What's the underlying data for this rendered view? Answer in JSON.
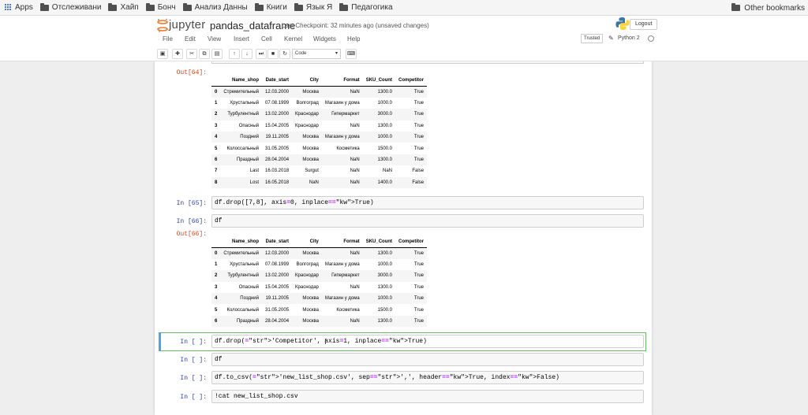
{
  "bookmarks": {
    "items": [
      "Apps",
      "Отслеживани",
      "Хайп",
      "Бонч",
      "Анализ Данны",
      "Книги",
      "Язык Я",
      "Педагогика"
    ],
    "other": "Other bookmarks"
  },
  "header": {
    "logo_text": "jupyter",
    "notebook_name": "pandas_dataframe",
    "checkpoint": "Last Checkpoint: 32 minutes ago (unsaved changes)",
    "logout": "Logout"
  },
  "menu": {
    "items": [
      "File",
      "Edit",
      "View",
      "Insert",
      "Cell",
      "Kernel",
      "Widgets",
      "Help"
    ],
    "trusted": "Trusted",
    "kernel": "Python 2"
  },
  "toolbar": {
    "cell_type": "Code"
  },
  "cells": {
    "out64_prompt": "Out[64]:",
    "in65_prompt": "In [65]:",
    "in65_code": "df.drop([7,8], axis=0, inplace=True)",
    "in66_prompt": "In [66]:",
    "in66_code": "df",
    "out66_prompt": "Out[66]:",
    "in_a_prompt": "In [ ]:",
    "in_a_code": "df.drop('Competitor', axis=1, inplace=True)",
    "in_b_prompt": "In [ ]:",
    "in_b_code": "df",
    "in_c_prompt": "In [ ]:",
    "in_c_code": "df.to_csv('new_list_shop.csv', sep=',', header=True, index=False)",
    "in_d_prompt": "In [ ]:",
    "in_d_code": "!cat new_list_shop.csv"
  },
  "table1": {
    "columns": [
      "",
      "Name_shop",
      "Date_start",
      "City",
      "Format",
      "SKU_Count",
      "Competitor"
    ],
    "rows": [
      [
        "0",
        "Стремительный",
        "12.03.2000",
        "Москва",
        "NaN",
        "1300.0",
        "True"
      ],
      [
        "1",
        "Хрустальный",
        "07.08.1999",
        "Волгоград",
        "Магазин у дома",
        "1000.0",
        "True"
      ],
      [
        "2",
        "Турбулентный",
        "13.02.2000",
        "Краснодар",
        "Гипермаркет",
        "3000.0",
        "True"
      ],
      [
        "3",
        "Опасный",
        "15.04.2005",
        "Краснодар",
        "NaN",
        "1300.0",
        "True"
      ],
      [
        "4",
        "Поздний",
        "19.11.2005",
        "Москва",
        "Магазин у дома",
        "1000.0",
        "True"
      ],
      [
        "5",
        "Колоссальный",
        "31.05.2005",
        "Москва",
        "Косметика",
        "1500.0",
        "True"
      ],
      [
        "6",
        "Праздный",
        "28.04.2004",
        "Москва",
        "NaN",
        "1300.0",
        "True"
      ],
      [
        "7",
        "Last",
        "16.03.2018",
        "Surgut",
        "NaN",
        "NaN",
        "False"
      ],
      [
        "8",
        "Lost",
        "16.05.2018",
        "NaN",
        "NaN",
        "1400.0",
        "False"
      ]
    ]
  },
  "table2": {
    "columns": [
      "",
      "Name_shop",
      "Date_start",
      "City",
      "Format",
      "SKU_Count",
      "Competitor"
    ],
    "rows": [
      [
        "0",
        "Стремительный",
        "12.03.2000",
        "Москва",
        "NaN",
        "1300.0",
        "True"
      ],
      [
        "1",
        "Хрустальный",
        "07.08.1999",
        "Волгоград",
        "Магазин у дома",
        "1000.0",
        "True"
      ],
      [
        "2",
        "Турбулентный",
        "13.02.2000",
        "Краснодар",
        "Гипермаркет",
        "3000.0",
        "True"
      ],
      [
        "3",
        "Опасный",
        "15.04.2005",
        "Краснодар",
        "NaN",
        "1300.0",
        "True"
      ],
      [
        "4",
        "Поздний",
        "19.11.2005",
        "Москва",
        "Магазин у дома",
        "1000.0",
        "True"
      ],
      [
        "5",
        "Колоссальный",
        "31.05.2005",
        "Москва",
        "Косметика",
        "1500.0",
        "True"
      ],
      [
        "6",
        "Праздный",
        "28.04.2004",
        "Москва",
        "NaN",
        "1300.0",
        "True"
      ]
    ]
  },
  "colors": {
    "in_prompt": "#303f9f",
    "out_prompt": "#d84315",
    "selected_border": "#66bb6a",
    "logo_orange": "#f37726"
  }
}
